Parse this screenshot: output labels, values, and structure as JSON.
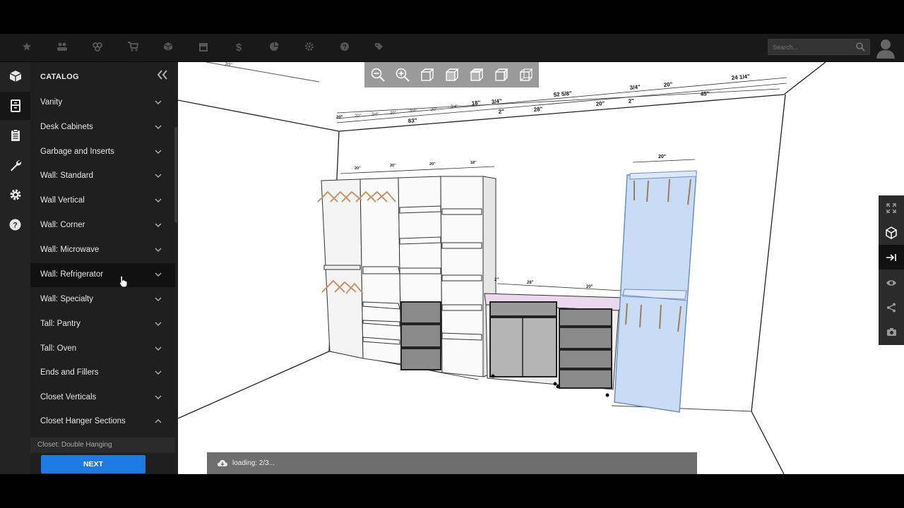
{
  "topbar": {
    "nav_icons": [
      "star-icon",
      "users-icon",
      "group-icon",
      "cart-icon",
      "box-icon",
      "store-icon",
      "dollar-icon",
      "pie-chart-icon",
      "gear-icon",
      "help-icon",
      "tag-icon"
    ],
    "search_placeholder": "Search..."
  },
  "rail": {
    "icons": [
      "box-icon",
      "cabinet-icon",
      "clipboard-icon",
      "wrench-icon",
      "gear-icon",
      "help-icon"
    ]
  },
  "catalog": {
    "title": "CATALOG",
    "items": [
      {
        "label": "Vanity"
      },
      {
        "label": "Desk Cabinets"
      },
      {
        "label": "Garbage and Inserts"
      },
      {
        "label": "Wall: Standard"
      },
      {
        "label": "Wall Vertical"
      },
      {
        "label": "Wall: Corner"
      },
      {
        "label": "Wall: Microwave"
      },
      {
        "label": "Wall: Refrigerator"
      },
      {
        "label": "Wall: Specialty"
      },
      {
        "label": "Tall: Pantry"
      },
      {
        "label": "Tall: Oven"
      },
      {
        "label": "Ends and Fillers"
      },
      {
        "label": "Closet Verticals"
      },
      {
        "label": "Closet Hanger Sections"
      }
    ],
    "expanded_item": "Closet Hanger Sections",
    "sub_item": "Closet: Double Hanging",
    "next_label": "NEXT"
  },
  "viewport": {
    "dimensions": {
      "top_total_a": "24 1/4\"",
      "top_total_b": "45\"",
      "top_20a": "20\"",
      "top_34": "3/4\"",
      "top_52": "52 5/8\"",
      "top_20b": "20\"",
      "top_2": "2\"",
      "top_28": "28\"",
      "top_2b": "2\"",
      "top_18": "18\"",
      "top_34b": "3/4\"",
      "top_83": "83\"",
      "corner_label": "20\"",
      "unit_20a": "20\"",
      "unit_20b": "20\"",
      "unit_20c": "20\"",
      "unit_18": "18\"",
      "base_2": "2\"",
      "base_28": "28\"",
      "base_20": "20\"",
      "tall_20": "20\""
    },
    "toolbar_icons": [
      "zoom-out-icon",
      "zoom-in-icon",
      "view-cube-front-icon",
      "view-cube-left-icon",
      "view-cube-top-icon",
      "view-cube-right-icon",
      "view-cube-iso-icon"
    ],
    "right_toolbar_icons": [
      "fullscreen-icon",
      "3d-box-icon",
      "arrow-to-right-icon",
      "eye-icon",
      "share-icon",
      "camera-icon"
    ],
    "loading_text": "loading: 2/3..."
  },
  "colors": {
    "accent": "#1e7be4",
    "selected_cabinet": "#c9dcf5",
    "countertop": "#ead9ee",
    "hanger": "#c8956a"
  }
}
